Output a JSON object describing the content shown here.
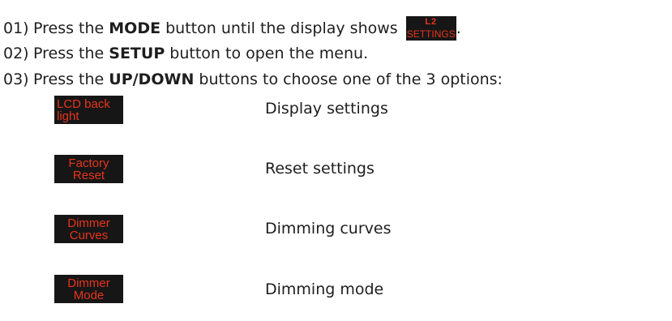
{
  "steps": [
    {
      "num": "01)",
      "pre": "Press the ",
      "bold": "MODE",
      "post": " button until the display shows ",
      "display": {
        "top": "L2",
        "bottom": "SETTINGS"
      },
      "end": "."
    },
    {
      "num": "02)",
      "pre": "Press the ",
      "bold": "SETUP",
      "post": " button to open the menu."
    },
    {
      "num": "03)",
      "pre": "Press the ",
      "bold": "UP/DOWN",
      "post": " buttons to choose one of the 3 options:"
    }
  ],
  "options": [
    {
      "display_line1": "LCD back",
      "display_line2": "light",
      "label": "Display settings"
    },
    {
      "display_line1": "Factory",
      "display_line2": "Reset",
      "label": "Reset settings"
    },
    {
      "display_line1": "Dimmer",
      "display_line2": "Curves",
      "label": "Dimming curves"
    },
    {
      "display_line1": "Dimmer",
      "display_line2": "Mode",
      "label": "Dimming mode"
    }
  ],
  "colors": {
    "display_bg": "#161616",
    "display_text": "#e8341c",
    "body_text": "#1e1e1e"
  }
}
